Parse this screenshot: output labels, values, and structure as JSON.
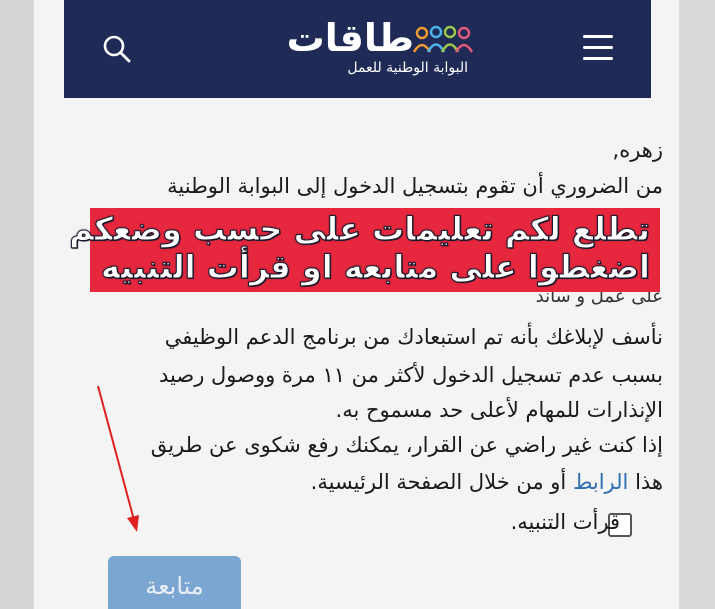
{
  "header": {
    "logo_text": "طاقات",
    "logo_subtitle": "البوابة الوطنية للعمل",
    "menu_icon": "hamburger-menu-icon",
    "search_icon": "search-icon",
    "bg_color": "#1f2a57"
  },
  "message": {
    "greeting": "زهره,",
    "line1": "من الضروري أن تقوم بتسجيل الدخول إلى البوابة الوطنية",
    "line_partial": "على عمل و ساند",
    "line2": "نأسف لإبلاغك بأنه تم استبعادك من برنامج الدعم الوظيفي",
    "line3": "بسبب عدم تسجيل الدخول لأكثر من ١١ مرة ووصول رصيد",
    "line4": "الإنذارات للمهام لأعلى حد مسموح به.",
    "line5": "إذا كنت غير راضي عن القرار، يمكنك رفع شكوى عن طريق",
    "line6_prefix": "هذا",
    "line6_link": "الرابط",
    "line6_suffix": "أو من خلال الصفحة الرئيسية."
  },
  "banner": {
    "line1": "تطلع لكم تعليمات على حسب وضعكم",
    "line2": "اضغطوا على متابعه او قرأت التنبيه",
    "bg_color": "#e6273d"
  },
  "checkbox": {
    "label": "قرأت التنبيه."
  },
  "continue_button": {
    "label": "متابعة",
    "color": "#7aa6d1"
  },
  "annotation": {
    "arrow_color": "#e02020"
  }
}
